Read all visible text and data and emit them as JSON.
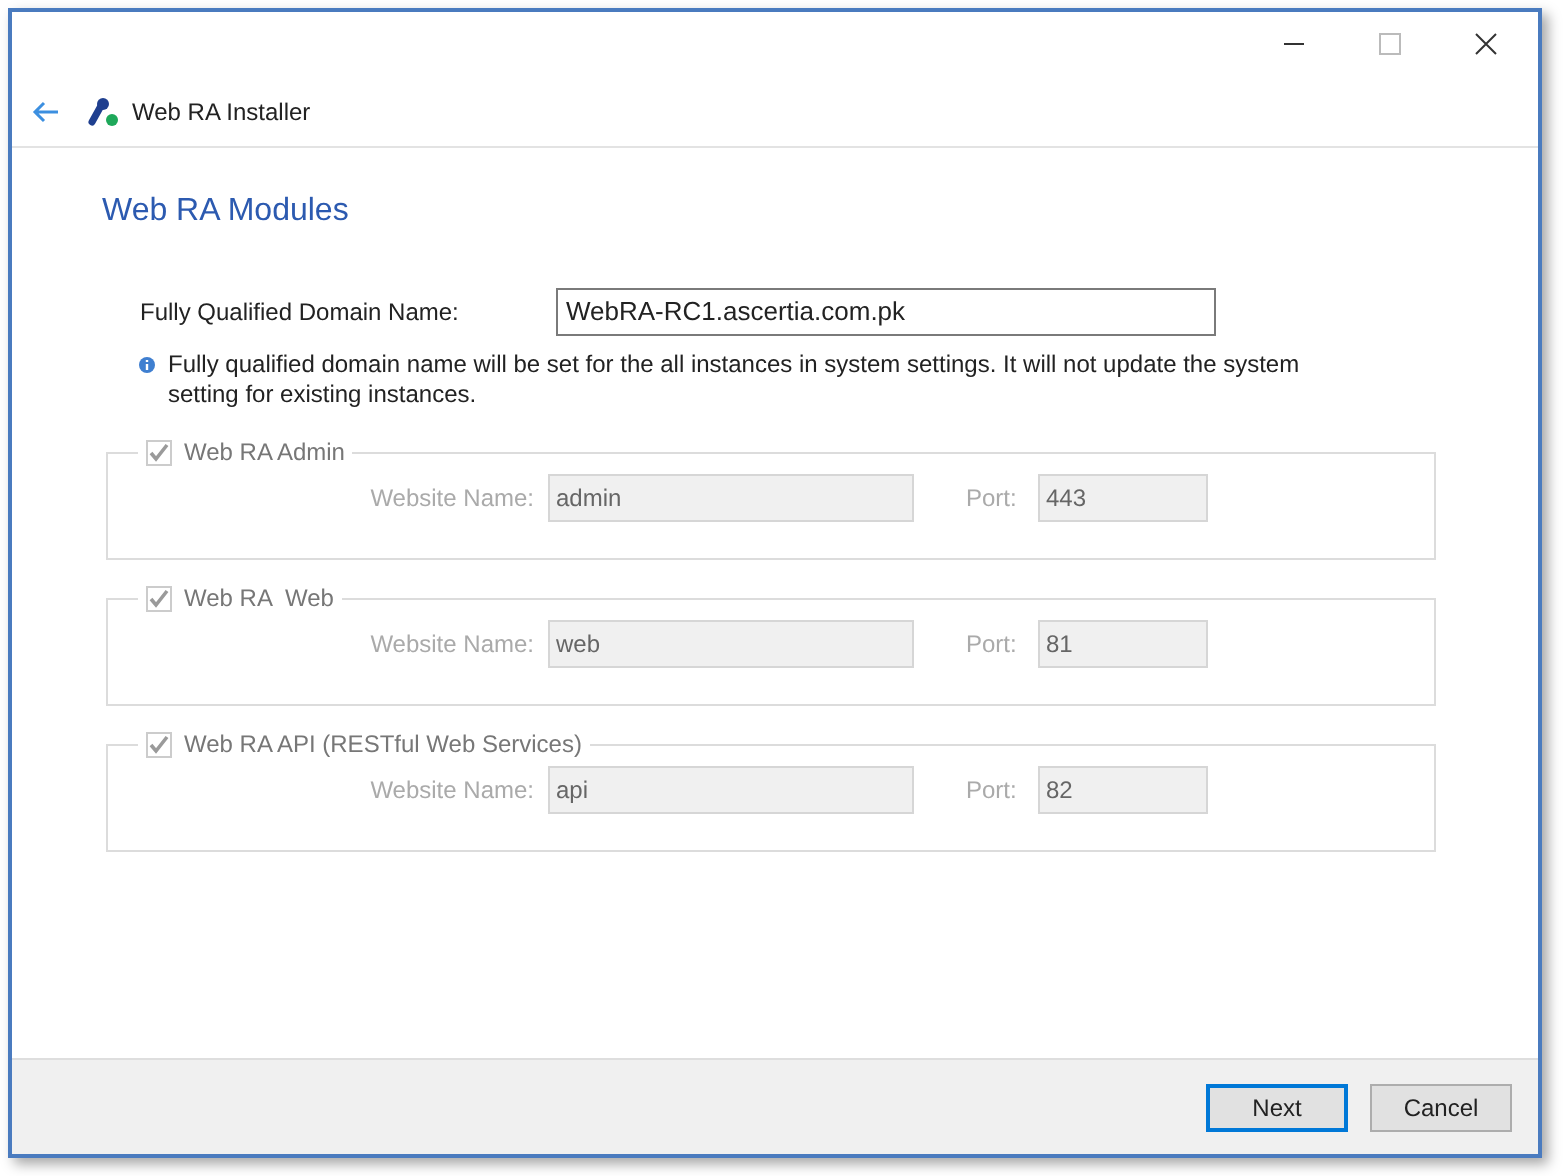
{
  "window": {
    "title": "Web RA Installer"
  },
  "page": {
    "heading": "Web RA Modules"
  },
  "fqdn": {
    "label": "Fully Qualified Domain Name:",
    "value": "WebRA-RC1.ascertia.com.pk"
  },
  "info": "Fully qualified domain name will be set for the all instances in system settings. It will not update the system setting for existing instances.",
  "modules": [
    {
      "name": "Web RA Admin",
      "checked": true,
      "disabled": true,
      "website_label": "Website Name:",
      "website": "admin",
      "port_label": "Port:",
      "port": "443"
    },
    {
      "name": "Web RA  Web",
      "checked": true,
      "disabled": true,
      "website_label": "Website Name:",
      "website": "web",
      "port_label": "Port:",
      "port": "81"
    },
    {
      "name": "Web RA API (RESTful Web Services)",
      "checked": true,
      "disabled": true,
      "website_label": "Website Name:",
      "website": "api",
      "port_label": "Port:",
      "port": "82"
    }
  ],
  "buttons": [
    {
      "label": "Next",
      "default": true
    },
    {
      "label": "Cancel",
      "default": false
    }
  ]
}
